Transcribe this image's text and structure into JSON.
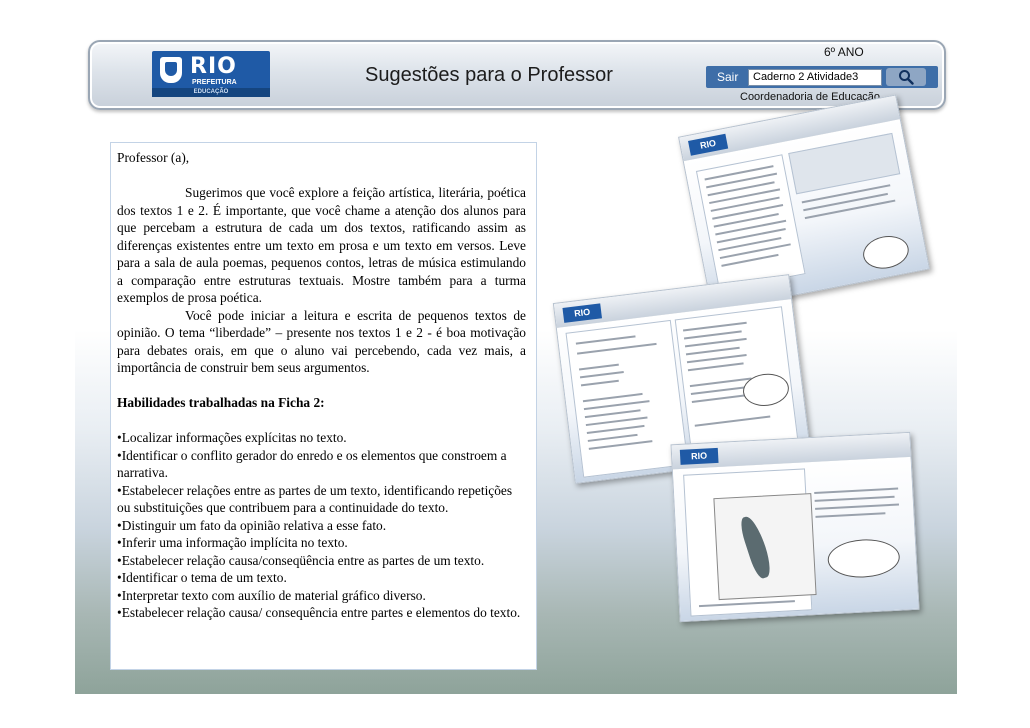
{
  "header": {
    "title": "Sugestões para o Professor",
    "grade": "6º ANO",
    "exit_label": "Sair",
    "navigation_value": "Caderno 2  Atividade3",
    "coordination": "Coordenadoria de Educação",
    "logo_text": "RIO",
    "logo_subtext": "PREFEITURA",
    "logo_department": "EDUCAÇÃO",
    "search_icon": "magnifier-icon"
  },
  "content": {
    "greeting": "Professor (a),",
    "paragraph1": "Sugerimos que você explore a feição artística, literária, poética dos textos 1 e 2. É importante, que você chame a atenção dos alunos para que percebam a estrutura de cada um dos textos, ratificando assim as diferenças existentes entre um texto em prosa e um texto em versos. Leve para a sala de aula poemas, pequenos contos, letras de música estimulando a comparação entre estruturas textuais. Mostre também para a turma exemplos de prosa poética.",
    "paragraph2": "Você pode iniciar a leitura e escrita de pequenos textos de opinião. O tema “liberdade” – presente nos textos 1 e 2 -  é boa motivação para debates orais, em que o aluno vai percebendo, cada vez mais, a importância de construir bem seus argumentos.",
    "skills_heading": "Habilidades trabalhadas na Ficha 2:",
    "skills": [
      "Localizar informações explícitas no texto.",
      "Identificar o conflito gerador do enredo e os elementos que constroem a narrativa.",
      "Estabelecer relações entre as partes de um texto, identificando repetições ou substituições que contribuem para a continuidade do texto.",
      "Distinguir um fato da opinião relativa a esse fato.",
      "Inferir uma informação implícita no texto.",
      "Estabelecer relação causa/conseqüência entre as partes de um texto.",
      "Identificar o tema de um texto.",
      "Interpretar texto com auxílio de material gráfico diverso.",
      "Estabelecer relação causa/ consequência entre partes e elementos do texto."
    ]
  },
  "thumbnails": {
    "logo_text": "RIO"
  },
  "colors": {
    "header_blue": "#3e6ea8",
    "logo_blue": "#1f5aa6",
    "textbox_border": "#c3d3e6"
  }
}
